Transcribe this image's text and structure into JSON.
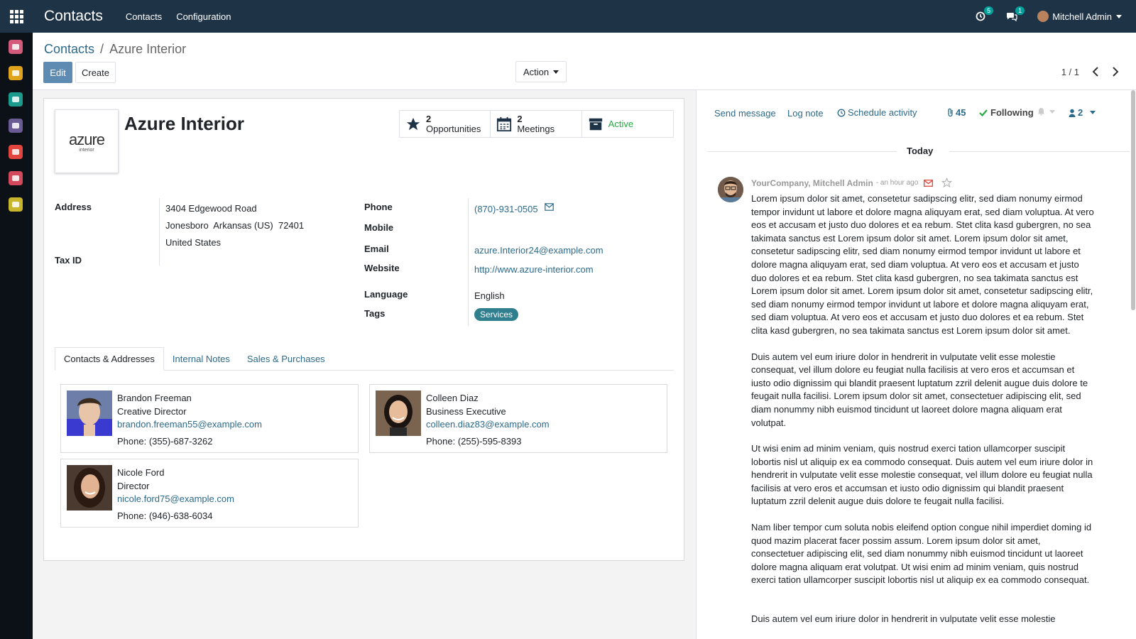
{
  "app": {
    "brand": "Contacts",
    "menu": [
      "Contacts",
      "Configuration"
    ],
    "activity_badge": "5",
    "message_badge": "1",
    "user": "Mitchell Admin"
  },
  "sidebar_apps": [
    {
      "name": "discuss",
      "color": "#d45a7b"
    },
    {
      "name": "calendar",
      "color": "#e0a31c"
    },
    {
      "name": "contacts",
      "color": "#1a9b8e"
    },
    {
      "name": "crm",
      "color": "#6a5b94"
    },
    {
      "name": "documents",
      "color": "#e2453d"
    },
    {
      "name": "employees",
      "color": "#d3495b"
    },
    {
      "name": "settings",
      "color": "#c9b52b"
    }
  ],
  "breadcrumb": {
    "parent": "Contacts",
    "separator": "/",
    "current": "Azure Interior"
  },
  "toolbar": {
    "edit": "Edit",
    "create": "Create",
    "action": "Action",
    "pager": "1 / 1"
  },
  "partner": {
    "logo_word": "azure",
    "logo_sub": "interior",
    "name": "Azure Interior",
    "smart_buttons": {
      "opportunities_count": "2",
      "opportunities_label": "Opportunities",
      "meetings_count": "2",
      "meetings_label": "Meetings",
      "active_label": "Active"
    },
    "labels": {
      "address": "Address",
      "tax_id": "Tax ID",
      "phone": "Phone",
      "mobile": "Mobile",
      "email": "Email",
      "website": "Website",
      "language": "Language",
      "tags": "Tags"
    },
    "address_line1": "3404 Edgewood Road",
    "address_line2": "Jonesboro  Arkansas (US)  72401",
    "address_line3": "United States",
    "phone": "(870)-931-0505",
    "email": "azure.Interior24@example.com",
    "website": "http://www.azure-interior.com",
    "language": "English",
    "tag": "Services"
  },
  "tabs": [
    "Contacts & Addresses",
    "Internal Notes",
    "Sales & Purchases"
  ],
  "contacts": [
    {
      "name": "Brandon Freeman",
      "title": "Creative Director",
      "email": "brandon.freeman55@example.com",
      "phone": "Phone: (355)-687-3262"
    },
    {
      "name": "Colleen Diaz",
      "title": "Business Executive",
      "email": "colleen.diaz83@example.com",
      "phone": "Phone: (255)-595-8393"
    },
    {
      "name": "Nicole Ford",
      "title": "Director",
      "email": "nicole.ford75@example.com",
      "phone": "Phone: (946)-638-6034"
    }
  ],
  "chatter": {
    "send_message": "Send message",
    "log_note": "Log note",
    "schedule_activity": "Schedule activity",
    "attachments": "45",
    "following": "Following",
    "followers": "2",
    "today": "Today",
    "author": "YourCompany, Mitchell Admin",
    "time": "- an hour ago",
    "paragraphs": [
      "Lorem ipsum dolor sit amet, consetetur sadipscing elitr, sed diam nonumy eirmod tempor invidunt ut labore et dolore magna aliquyam erat, sed diam voluptua. At vero eos et accusam et justo duo dolores et ea rebum. Stet clita kasd gubergren, no sea takimata sanctus est Lorem ipsum dolor sit amet. Lorem ipsum dolor sit amet, consetetur sadipscing elitr, sed diam nonumy eirmod tempor invidunt ut labore et dolore magna aliquyam erat, sed diam voluptua. At vero eos et accusam et justo duo dolores et ea rebum. Stet clita kasd gubergren, no sea takimata sanctus est Lorem ipsum dolor sit amet. Lorem ipsum dolor sit amet, consetetur sadipscing elitr, sed diam nonumy eirmod tempor invidunt ut labore et dolore magna aliquyam erat, sed diam voluptua. At vero eos et accusam et justo duo dolores et ea rebum. Stet clita kasd gubergren, no sea takimata sanctus est Lorem ipsum dolor sit amet.",
      "Duis autem vel eum iriure dolor in hendrerit in vulputate velit esse molestie consequat, vel illum dolore eu feugiat nulla facilisis at vero eros et accumsan et iusto odio dignissim qui blandit praesent luptatum zzril delenit augue duis dolore te feugait nulla facilisi. Lorem ipsum dolor sit amet, consectetuer adipiscing elit, sed diam nonummy nibh euismod tincidunt ut laoreet dolore magna aliquam erat volutpat.",
      "Ut wisi enim ad minim veniam, quis nostrud exerci tation ullamcorper suscipit lobortis nisl ut aliquip ex ea commodo consequat. Duis autem vel eum iriure dolor in hendrerit in vulputate velit esse molestie consequat, vel illum dolore eu feugiat nulla facilisis at vero eros et accumsan et iusto odio dignissim qui blandit praesent luptatum zzril delenit augue duis dolore te feugait nulla facilisi.",
      "Nam liber tempor cum soluta nobis eleifend option congue nihil imperdiet doming id quod mazim placerat facer possim assum. Lorem ipsum dolor sit amet, consectetuer adipiscing elit, sed diam nonummy nibh euismod tincidunt ut laoreet dolore magna aliquam erat volutpat. Ut wisi enim ad minim veniam, quis nostrud exerci tation ullamcorper suscipit lobortis nisl ut aliquip ex ea commodo consequat.",
      "Duis autem vel eum iriure dolor in hendrerit in vulputate velit esse molestie"
    ]
  },
  "colors": {
    "navbar": "#1f3347",
    "primary": "#5e8bb2",
    "link": "#2c6a8c",
    "tag": "#2f7f8f",
    "active": "#28a745"
  }
}
